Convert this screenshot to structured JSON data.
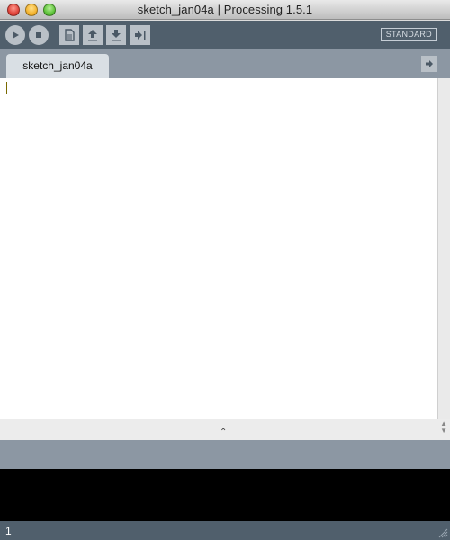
{
  "window": {
    "title": "sketch_jan04a | Processing 1.5.1"
  },
  "toolbar": {
    "buttons": [
      {
        "name": "run",
        "icon": "play-icon"
      },
      {
        "name": "stop",
        "icon": "stop-icon"
      },
      {
        "name": "new",
        "icon": "new-document-icon"
      },
      {
        "name": "open",
        "icon": "open-arrow-up-icon"
      },
      {
        "name": "save",
        "icon": "save-arrow-down-icon"
      },
      {
        "name": "export",
        "icon": "export-arrow-icon"
      }
    ],
    "mode_label": "STANDARD"
  },
  "tabs": [
    {
      "label": "sketch_jan04a",
      "active": true
    }
  ],
  "editor": {
    "content": ""
  },
  "status": {
    "line_number": "1"
  },
  "colors": {
    "toolbar": "#505f6c",
    "tabstrip": "#8c97a3",
    "console": "#000000",
    "button": "#b9c0c7"
  }
}
